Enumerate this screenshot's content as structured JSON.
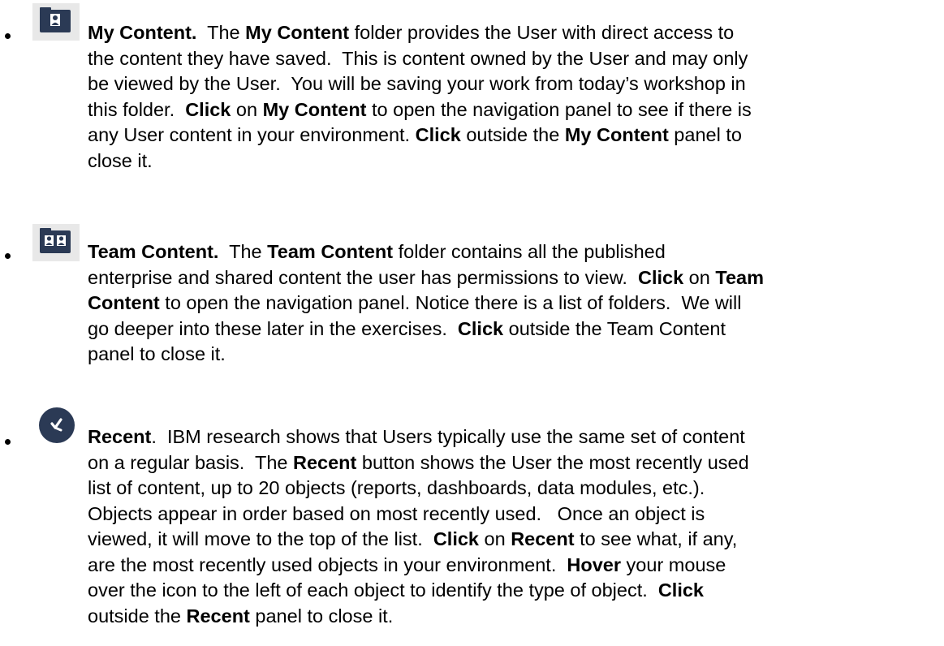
{
  "items": [
    {
      "id": "my_content",
      "icon": "person-folder-icon",
      "lines": [
        [
          {
            "t": "My Content.",
            "b": true
          },
          {
            "t": "  The ",
            "b": false
          },
          {
            "t": "My Content",
            "b": true
          },
          {
            "t": " folder provides the User with direct access to",
            "b": false
          }
        ],
        [
          {
            "t": "the content they have saved.  This is content owned by the User and may only",
            "b": false
          }
        ],
        [
          {
            "t": "be viewed by the User.  You will be saving your work from today’s workshop in",
            "b": false
          }
        ],
        [
          {
            "t": "this folder.  ",
            "b": false
          },
          {
            "t": "Click",
            "b": true
          },
          {
            "t": " on ",
            "b": false
          },
          {
            "t": "My Content",
            "b": true
          },
          {
            "t": " to open the navigation panel to see if there is",
            "b": false
          }
        ],
        [
          {
            "t": "any User content in your environment. ",
            "b": false
          },
          {
            "t": "Click",
            "b": true
          },
          {
            "t": " outside the ",
            "b": false
          },
          {
            "t": "My Content",
            "b": true
          },
          {
            "t": " panel to",
            "b": false
          }
        ],
        [
          {
            "t": "close it.",
            "b": false
          }
        ]
      ]
    },
    {
      "id": "team_content",
      "icon": "team-folder-icon",
      "lines": [
        [
          {
            "t": "Team Content.",
            "b": true
          },
          {
            "t": "  The ",
            "b": false
          },
          {
            "t": "Team Content",
            "b": true
          },
          {
            "t": " folder contains all the published",
            "b": false
          }
        ],
        [
          {
            "t": "enterprise and shared content the user has permissions to view.  ",
            "b": false
          },
          {
            "t": "Click",
            "b": true
          },
          {
            "t": " on ",
            "b": false
          },
          {
            "t": "Team",
            "b": true
          }
        ],
        [
          {
            "t": "Content",
            "b": true
          },
          {
            "t": " to open the navigation panel. Notice there is a list of folders.  We will",
            "b": false
          }
        ],
        [
          {
            "t": "go deeper into these later in the exercises.  ",
            "b": false
          },
          {
            "t": "Click",
            "b": true
          },
          {
            "t": " outside the Team Content",
            "b": false
          }
        ],
        [
          {
            "t": "panel to close it.",
            "b": false
          }
        ]
      ]
    },
    {
      "id": "recent",
      "icon": "recent-clock-icon",
      "lines": [
        [
          {
            "t": "Recent",
            "b": true
          },
          {
            "t": ".  IBM research shows that Users typically use the same set of content",
            "b": false
          }
        ],
        [
          {
            "t": "on a regular basis.  The ",
            "b": false
          },
          {
            "t": "Recent",
            "b": true
          },
          {
            "t": " button shows the User the most recently used",
            "b": false
          }
        ],
        [
          {
            "t": "list of content, up to 20 objects (reports, dashboards, data modules, etc.).",
            "b": false
          }
        ],
        [
          {
            "t": "Objects appear in order based on most recently used.   Once an object is",
            "b": false
          }
        ],
        [
          {
            "t": "viewed, it will move to the top of the list.  ",
            "b": false
          },
          {
            "t": "Click",
            "b": true
          },
          {
            "t": " on ",
            "b": false
          },
          {
            "t": "Recent",
            "b": true
          },
          {
            "t": " to see what, if any,",
            "b": false
          }
        ],
        [
          {
            "t": "are the most recently used objects in your environment.  ",
            "b": false
          },
          {
            "t": "Hover",
            "b": true
          },
          {
            "t": " your mouse",
            "b": false
          }
        ],
        [
          {
            "t": "over the icon to the left of each object to identify the type of object.  ",
            "b": false
          },
          {
            "t": "Click",
            "b": true
          }
        ],
        [
          {
            "t": "outside the ",
            "b": false
          },
          {
            "t": "Recent",
            "b": true
          },
          {
            "t": " panel to close it.",
            "b": false
          }
        ]
      ]
    }
  ],
  "colors": {
    "icon_bg": "#e4e4e4",
    "icon_dark": "#2b3a55",
    "text": "#000000"
  }
}
